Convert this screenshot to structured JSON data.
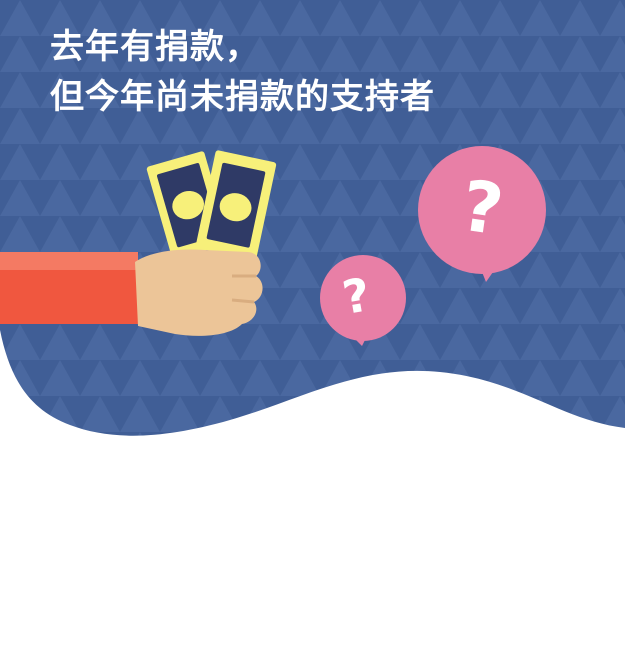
{
  "headline": {
    "line1": "去年有捐款，",
    "line2": "但今年尚未捐款的支持者"
  },
  "colors": {
    "banner_background": "#44629a",
    "banner_pattern": "#4e6ca4",
    "sleeve": "#f0573f",
    "hand": "#ecc598",
    "money": "#f7f07a",
    "money_dark": "#2f3a66",
    "bubble": "#e87fa6",
    "text": "#ffffff"
  },
  "icons": [
    "money-icon",
    "hand-icon",
    "question-bubble-icon"
  ]
}
